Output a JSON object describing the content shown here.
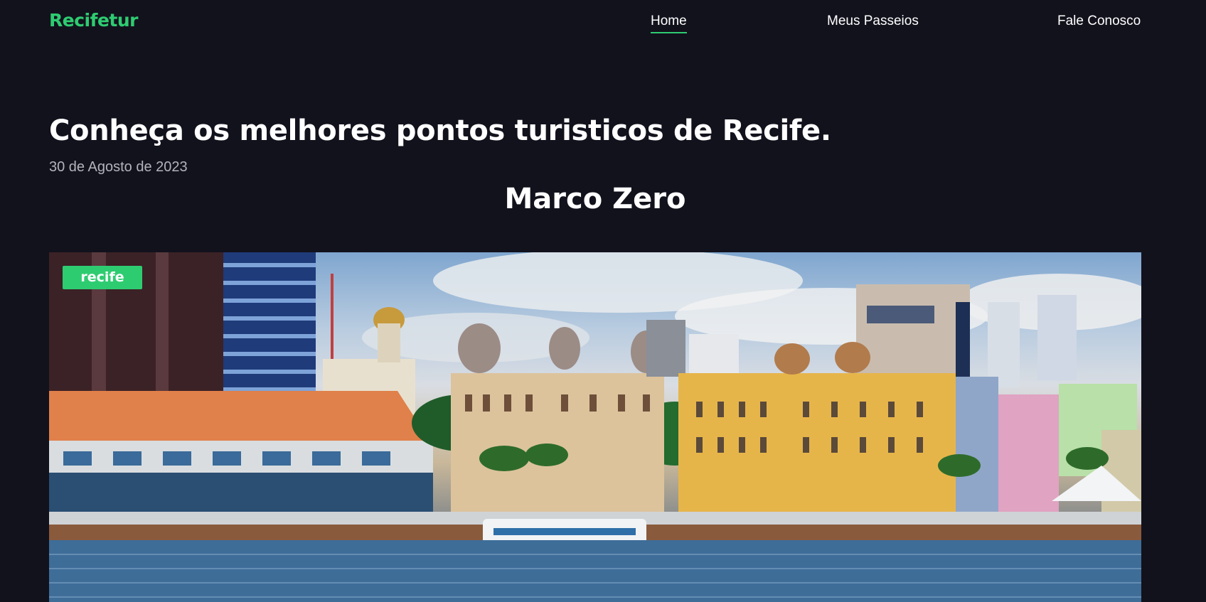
{
  "brand": {
    "name": "Recifetur",
    "color": "#2ecc71"
  },
  "nav": {
    "items": [
      {
        "label": "Home",
        "active": true
      },
      {
        "label": "Meus Passeios",
        "active": false
      },
      {
        "label": "Fale Conosco",
        "active": false
      }
    ]
  },
  "article": {
    "title": "Conheça os melhores pontos turisticos de Recife.",
    "date": "30 de Agosto de 2023",
    "section_title": "Marco Zero",
    "image": {
      "tag": "recife",
      "description_icon": "photo-recife-waterfront"
    }
  },
  "colors": {
    "background": "#12121d",
    "accent": "#2ecc71",
    "muted_text": "#b3b3bb"
  }
}
